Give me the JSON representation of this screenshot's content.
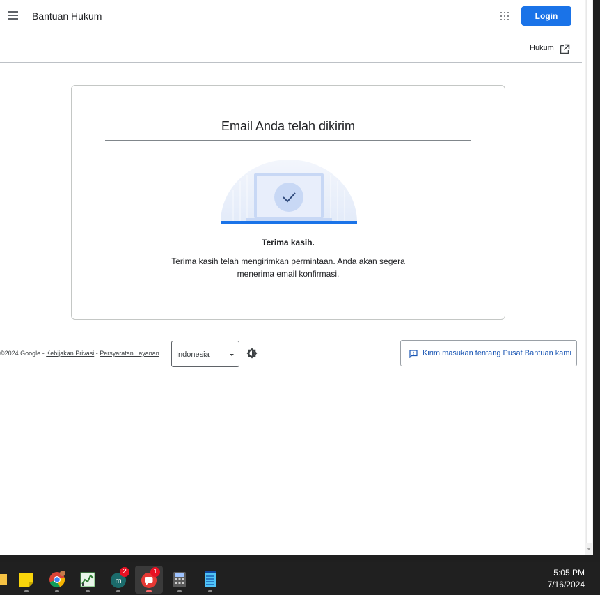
{
  "header": {
    "app_title": "Bantuan Hukum",
    "login_label": "Login",
    "hukum_link": "Hukum"
  },
  "card": {
    "title": "Email Anda telah dikirim",
    "thanks_title": "Terima kasih.",
    "thanks_text": "Terima kasih telah mengirimkan permintaan. Anda akan segera menerima email konfirmasi."
  },
  "footer": {
    "copyright": "©2024 Google",
    "separator": " - ",
    "privacy_link": "Kebijakan Privasi",
    "terms_link": "Persyaratan Layanan",
    "language_selected": "Indonesia",
    "feedback_label": "Kirim masukan tentang Pusat Bantuan kami"
  },
  "taskbar": {
    "items": [
      {
        "icon": "file-explorer-icon"
      },
      {
        "icon": "sticky-notes-icon"
      },
      {
        "icon": "chrome-icon"
      },
      {
        "icon": "task-manager-icon"
      },
      {
        "icon": "chat-app-icon",
        "badge": "2"
      },
      {
        "icon": "messenger-icon",
        "badge": "1"
      },
      {
        "icon": "calculator-icon"
      },
      {
        "icon": "notepad-icon"
      }
    ],
    "time": "5:05 PM",
    "date": "7/16/2024"
  },
  "colors": {
    "accent": "#1a73e8",
    "taskbar": "#202020",
    "badge": "#e81123"
  }
}
